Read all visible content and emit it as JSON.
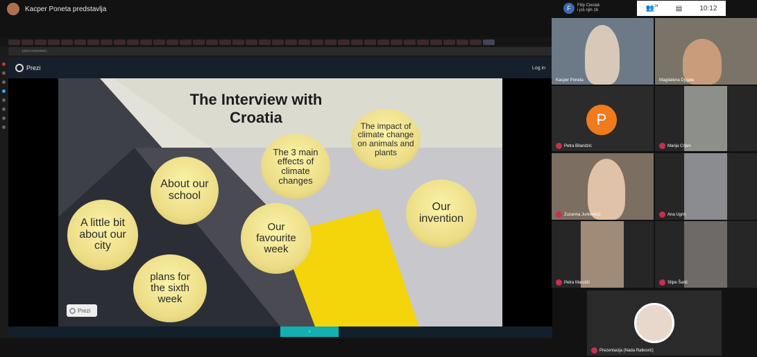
{
  "presenter": {
    "label": "Kacper Poneta predstavlja"
  },
  "browser": {
    "address": "prezi.com/view/..."
  },
  "prezi": {
    "logo": "Prezi",
    "login": "Log in",
    "badge": "Prezi",
    "title": "The Interview with Croatia",
    "bubbles": [
      "About our school",
      "A little bit about our city",
      "plans for the sixth week",
      "The 3 main effects of climate changes",
      "The impact of climate change on animals and plants",
      "Our favourite week",
      "Our invention"
    ]
  },
  "teams": {
    "avatar_letter": "F",
    "caller_name": "Filip Cieslak",
    "caller_sub": "i još njih 16",
    "participant_count": "24",
    "time": "10:12"
  },
  "participants": [
    {
      "name": "Kacper Poneta"
    },
    {
      "name": "Magdalena Dygała"
    },
    {
      "name": "Petra Bilandzic",
      "avatar": "P"
    },
    {
      "name": "Marija Crljen"
    },
    {
      "name": "Zuzanna Jurkiewicz"
    },
    {
      "name": "Ana Ugrin"
    },
    {
      "name": "Petra Marušić"
    },
    {
      "name": "Stipe Šarić"
    },
    {
      "name": "Prezentacija (Nada Ratković)"
    }
  ],
  "colors": {
    "teams_red": "#c4314b",
    "prezi_teal": "#12b0b0",
    "bubble_yellow": "#f2e68e",
    "slide_yellow": "#f4d40a"
  }
}
